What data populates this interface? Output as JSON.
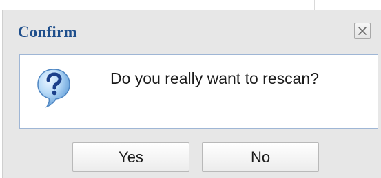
{
  "dialog": {
    "title": "Confirm",
    "message": "Do you really want to rescan?",
    "icon": "question-icon",
    "close_icon": "close-icon",
    "buttons": {
      "yes_label": "Yes",
      "no_label": "No"
    }
  },
  "colors": {
    "title_text": "#1f4f8c",
    "dialog_background": "#e7e7e7",
    "content_border": "#9fb6d5",
    "icon_blue": "#2e78c7"
  }
}
